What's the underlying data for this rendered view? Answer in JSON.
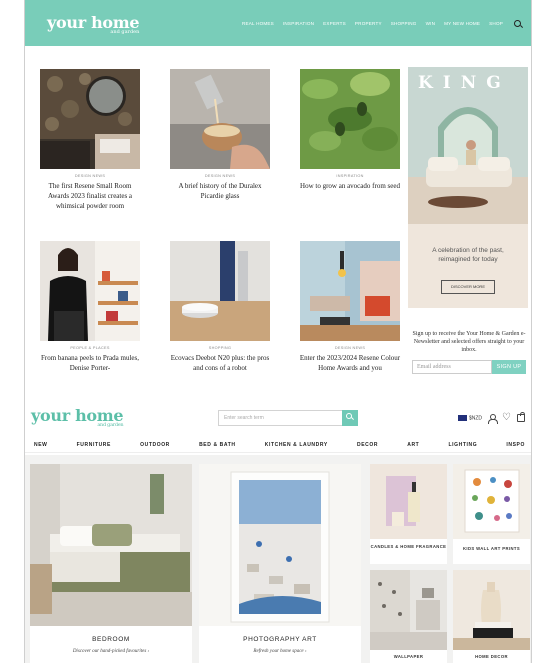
{
  "header": {
    "logo": "your home",
    "logo_sub": "and garden",
    "nav": [
      "REAL HOMES",
      "INSPIRATION",
      "EXPERTS",
      "PROPERTY",
      "SHOPPING",
      "WIN",
      "MY NEW HOME",
      "SHOP"
    ]
  },
  "articles": [
    {
      "category": "DESIGN NEWS",
      "title": "The first Resene Small Room Awards 2023 finalist creates a whimsical powder room"
    },
    {
      "category": "DESIGN NEWS",
      "title": "A brief history of the Duralex Picardie glass"
    },
    {
      "category": "INSPIRATION",
      "title": "How to grow an avocado from seed"
    },
    {
      "category": "PEOPLE & PLACES",
      "title": "From banana peels to Prada mules, Denise Porter-"
    },
    {
      "category": "SHOPPING",
      "title": "Ecovacs Deebot N20 plus: the pros and cons of a robot"
    },
    {
      "category": "DESIGN NEWS",
      "title": "Enter the 2023/2024 Resene Colour Home Awards and you"
    }
  ],
  "ad": {
    "brand": "KING",
    "tagline": "A celebration of the past, reimagined for today",
    "button": "DISCOVER MORE"
  },
  "newsletter": {
    "text": "Sign up to receive the Your Home & Garden e-Newsletter and selected offers straight to your inbox.",
    "placeholder": "Email address",
    "button": "SIGN UP"
  },
  "shop": {
    "logo": "your home",
    "logo_sub": "and garden",
    "search_placeholder": "Enter search term",
    "currency": "$NZD",
    "categories": [
      "NEW",
      "FURNITURE",
      "OUTDOOR",
      "BED & BATH",
      "KITCHEN & LAUNDRY",
      "DECOR",
      "ART",
      "LIGHTING",
      "INSPO"
    ],
    "tiles": {
      "bedroom": {
        "label": "BEDROOM",
        "sub": "Discover our hand-picked favourites ›"
      },
      "photo": {
        "label": "PHOTOGRAPHY ART",
        "sub": "Refresh your home space ›"
      },
      "candles": {
        "label": "CANDLES & HOME FRAGRANCE"
      },
      "kids": {
        "label": "KIDS WALL ART PRINTS"
      },
      "wallpaper": {
        "label": "WALLPAPER"
      },
      "decor": {
        "label": "HOME DECOR"
      }
    }
  },
  "colors": {
    "brand": "#79cdb9",
    "accent": "#6fc9b6"
  }
}
